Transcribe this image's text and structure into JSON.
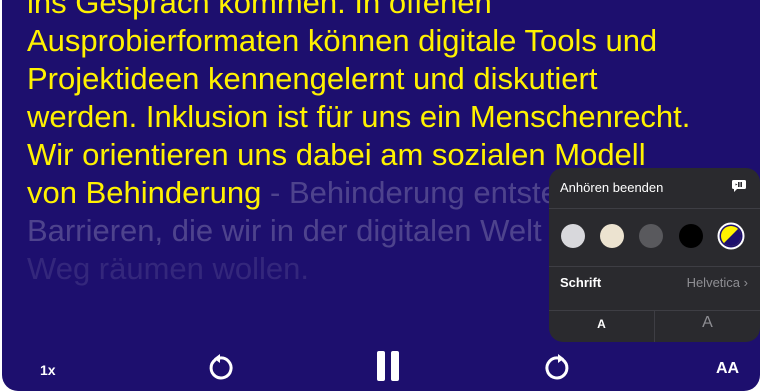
{
  "reader": {
    "line1": "ins Gespräch kommen. In offenen",
    "line2": "Ausprobierformaten können digitale Tools und",
    "line3": "Projektideen kennengelernt und diskutiert",
    "line4": "werden. Inklusion ist für uns ein Menschenrecht.",
    "line5": "Wir orientieren uns dabei am sozialen Modell",
    "line6_spoken": "von Behinderung",
    "line6_rest": " - Behinderung entsteht durch",
    "line7": "Barrieren, die wir in der digitalen Welt aus dem",
    "line8": "Weg räumen wollen."
  },
  "controls": {
    "speed_label": "1x",
    "rewind_icon": "rewind-icon",
    "pause_icon": "pause-icon",
    "forward_icon": "forward-icon",
    "text_size_label": "AA"
  },
  "panel": {
    "stop_label": "Anhören beenden",
    "stop_icon": "speech-bubble-stop-icon",
    "themes": [
      {
        "name": "light-gray",
        "color": "#d8d8dc"
      },
      {
        "name": "sepia",
        "color": "#ece3d0"
      },
      {
        "name": "dark-gray",
        "color": "#59595d"
      },
      {
        "name": "black",
        "color": "#000000"
      },
      {
        "name": "yellow-on-blue",
        "color": "#fff200",
        "selected": true
      }
    ],
    "font_label": "Schrift",
    "font_value": "Helvetica",
    "size_small_label": "A",
    "size_large_label": "A"
  },
  "colors": {
    "background": "#1d0f6e",
    "text": "#fff200",
    "panel": "#2a2a2e"
  }
}
